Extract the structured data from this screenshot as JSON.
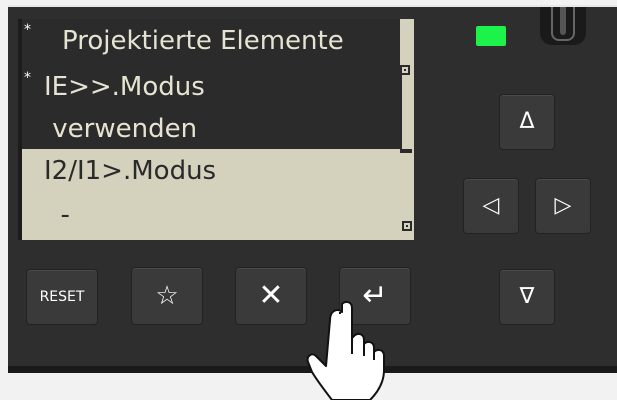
{
  "lcd": {
    "title": "Projektierte Elemente",
    "marker": "*",
    "rows": [
      {
        "text": "IE>>.Modus",
        "selected": true,
        "marked": true
      },
      {
        "text": " verwenden",
        "selected": true,
        "marked": false
      },
      {
        "text": "I2/I1>.Modus",
        "selected": false,
        "marked": false
      },
      {
        "text": "  -",
        "selected": false,
        "marked": false
      }
    ]
  },
  "status_led": {
    "color": "#1df24a"
  },
  "buttons": {
    "reset_label": "RESET",
    "favorite_glyph": "☆",
    "cancel_glyph": "✕",
    "enter_glyph": "↵",
    "up_glyph": "Δ",
    "left_glyph": "◁",
    "right_glyph": "▷",
    "down_glyph": "∇"
  }
}
